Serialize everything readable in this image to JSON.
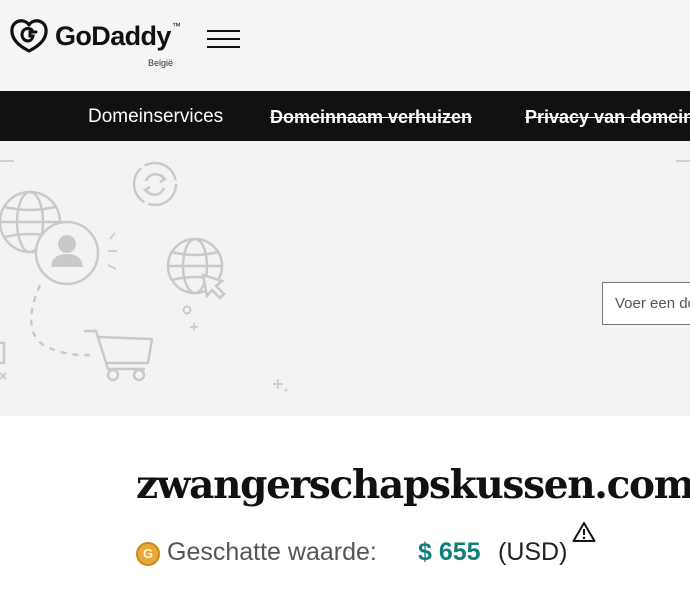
{
  "header": {
    "logo_text": "GoDaddy",
    "logo_tm": "™",
    "region": "België",
    "menu_icon": "hamburger-icon"
  },
  "nav": {
    "items": [
      {
        "label": "Domeinservices",
        "strikethrough": false
      },
      {
        "label": "Domeinnaam verhuizen",
        "strikethrough": true
      },
      {
        "label": "Privacy van domeinen",
        "strikethrough": true
      }
    ]
  },
  "hero": {
    "search_placeholder": "Voer een domeinnaam in",
    "icons": [
      "globe-icon",
      "user-icon",
      "refresh-icon",
      "globe-cursor-icon",
      "shopping-cart-icon"
    ]
  },
  "domain": {
    "name": "zwangerschapskussen.com",
    "value_label": "Geschatte waarde:",
    "value_amount": "$ 655",
    "value_currency": "(USD)",
    "value_icon": "coin-icon",
    "warning_icon": "warning-icon"
  },
  "colors": {
    "header_bg": "#f5f5f5",
    "nav_bg": "#111111",
    "hero_bg": "#f3f3f3",
    "value_amount": "#127d7d"
  }
}
